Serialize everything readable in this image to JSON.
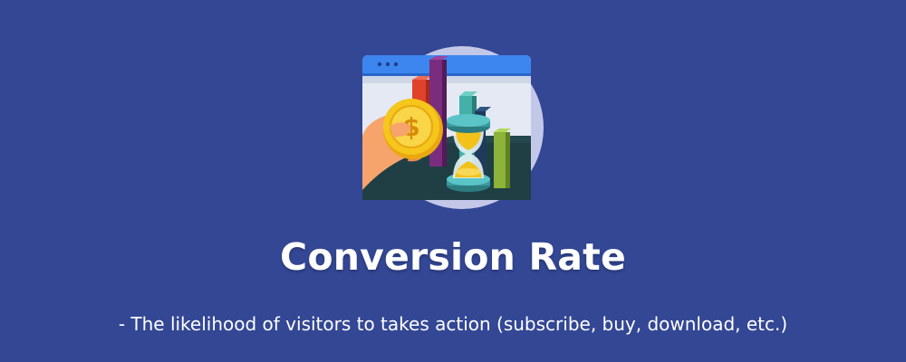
{
  "title": "Conversion Rate",
  "subtitle": "- The likelihood of visitors to takes action (subscribe, buy, download, etc.)",
  "colors": {
    "background": "#334795",
    "circle": "#c4c8e8",
    "browser_bar": "#3d86f0",
    "coin": "#f2c21b",
    "hand": "#f6a46c"
  },
  "icons": [
    "browser-window-icon",
    "coin-icon",
    "hourglass-icon",
    "bar-chart-icon",
    "hand-icon"
  ]
}
